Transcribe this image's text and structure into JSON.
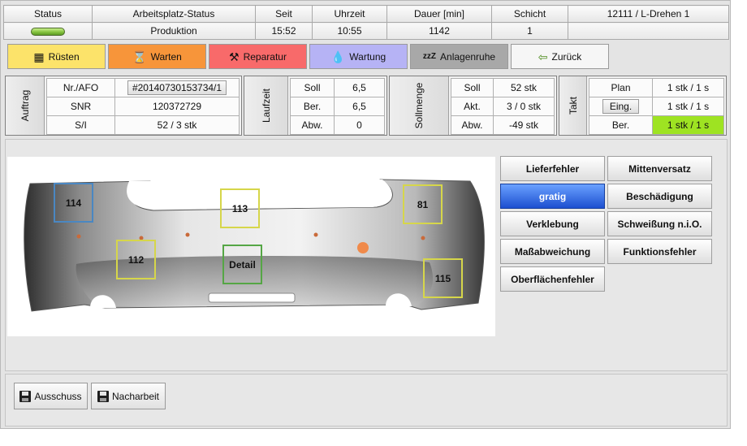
{
  "status_table": {
    "headers": {
      "status": "Status",
      "arbeitsplatz_status": "Arbeitsplatz-Status",
      "seit": "Seit",
      "uhrzeit": "Uhrzeit",
      "dauer": "Dauer [min]",
      "schicht": "Schicht",
      "machine": "12111  / L-Drehen 1"
    },
    "values": {
      "status_light_color": "#7fbf3b",
      "arbeitsplatz_status": "Produktion",
      "seit": "15:52",
      "uhrzeit": "10:55",
      "dauer": "1142",
      "schicht": "1",
      "machine": ""
    }
  },
  "actions": {
    "ruesten": {
      "label": "Rüsten",
      "icon": "setup-icon",
      "color": "#fce36a"
    },
    "warten": {
      "label": "Warten",
      "icon": "hourglass-icon",
      "color": "#f7953a"
    },
    "reparatur": {
      "label": "Reparatur",
      "icon": "tools-icon",
      "color": "#f86a6a"
    },
    "wartung": {
      "label": "Wartung",
      "icon": "oil-drop-icon",
      "color": "#b6b3f5"
    },
    "anlagenruhe": {
      "label": "Anlagenruhe",
      "icon": "sleep-icon",
      "color": "#a8a8a8"
    },
    "zurueck": {
      "label": "Zurück",
      "icon": "arrow-left-icon",
      "color": "#f6f6f6"
    }
  },
  "auftrag": {
    "title": "Auftrag",
    "rows": [
      {
        "label": "Nr./AFO",
        "value": "#20140730153734/1"
      },
      {
        "label": "SNR",
        "value": "120372729"
      },
      {
        "label": "S/I",
        "value": "52  / 3 stk"
      }
    ]
  },
  "laufzeit": {
    "title": "Laufzeit",
    "rows": [
      {
        "label": "Soll",
        "value": "6,5"
      },
      {
        "label": "Ber.",
        "value": "6,5"
      },
      {
        "label": "Abw.",
        "value": "0"
      }
    ]
  },
  "sollmenge": {
    "title": "Sollmenge",
    "rows": [
      {
        "label": "Soll",
        "value": "52 stk"
      },
      {
        "label": "Akt.",
        "value": "3  / 0 stk"
      },
      {
        "label": "Abw.",
        "value": "-49 stk"
      }
    ]
  },
  "takt": {
    "title": "Takt",
    "rows": [
      {
        "label": "Plan",
        "value": "1 stk  / 1 s"
      },
      {
        "label": "Eing.",
        "value": "1 stk  / 1 s"
      },
      {
        "label": "Ber.",
        "value": "1 stk  / 1 s"
      }
    ],
    "highlight_color": "#9ee322"
  },
  "zones": {
    "z114": "114",
    "z113": "113",
    "z81": "81",
    "z112": "112",
    "zdetail": "Detail",
    "z115": "115"
  },
  "defects": {
    "lieferfehler": "Lieferfehler",
    "mittenversatz": "Mittenversatz",
    "gratig": "gratig",
    "beschaedigung": "Beschädigung",
    "verklebung": "Verklebung",
    "schweissung": "Schweißung n.i.O.",
    "massabweichung": "Maßabweichung",
    "funktionsfehler": "Funktionsfehler",
    "oberflaechenfehler": "Oberflächenfehler",
    "selected": "gratig"
  },
  "bottom": {
    "ausschuss": "Ausschuss",
    "nacharbeit": "Nacharbeit"
  }
}
